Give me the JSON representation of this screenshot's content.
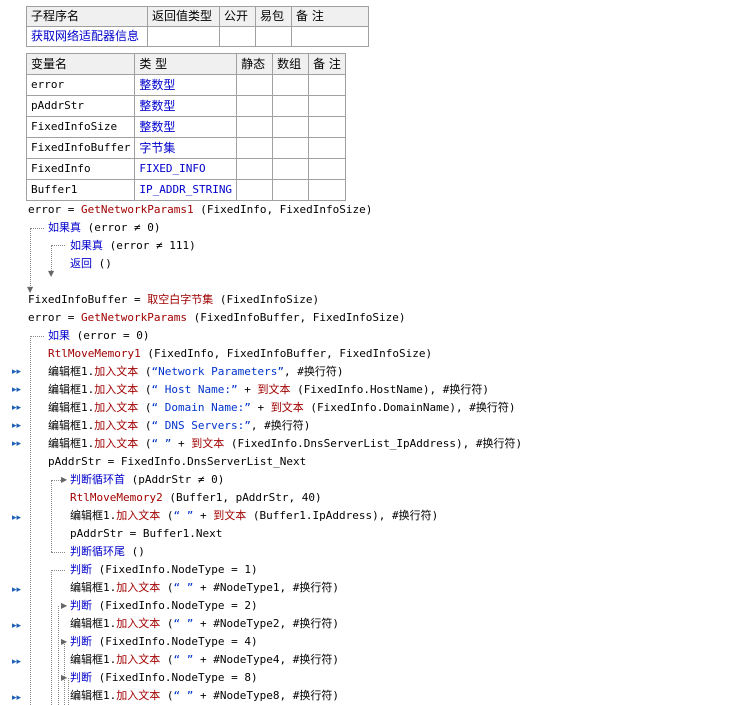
{
  "proc_table": {
    "headers": [
      "子程序名",
      "返回值类型",
      "公开",
      "易包",
      "备 注"
    ],
    "row": [
      "获取网络适配器信息",
      "",
      "",
      "",
      ""
    ]
  },
  "var_table": {
    "headers": [
      "变量名",
      "类 型",
      "静态",
      "数组",
      "备 注"
    ],
    "rows": [
      {
        "name": "error",
        "type": "整数型"
      },
      {
        "name": "pAddrStr",
        "type": "整数型"
      },
      {
        "name": "FixedInfoSize",
        "type": "整数型"
      },
      {
        "name": "FixedInfoBuffer",
        "type": "字节集"
      },
      {
        "name": "FixedInfo",
        "type": "FIXED_INFO"
      },
      {
        "name": "Buffer1",
        "type": "IP_ADDR_STRING"
      }
    ]
  },
  "code": {
    "l1": {
      "a": "error",
      "b": " = ",
      "c": "GetNetworkParams1",
      "d": " (FixedInfo, FixedInfoSize)"
    },
    "l2": {
      "a": "如果真",
      "b": " (error ≠ 0)"
    },
    "l3": {
      "a": "如果真",
      "b": " (error ≠ 111)"
    },
    "l4": {
      "a": "返回",
      "b": " ()"
    },
    "l5": {
      "a": "FixedInfoBuffer = ",
      "b": "取空白字节集",
      "c": " (FixedInfoSize)"
    },
    "l6": {
      "a": "error = ",
      "b": "GetNetworkParams",
      "c": " (FixedInfoBuffer, FixedInfoSize)"
    },
    "l7": {
      "a": "如果",
      "b": " (error = 0)"
    },
    "l8": {
      "a": "RtlMoveMemory1",
      "b": " (FixedInfo, FixedInfoBuffer, FixedInfoSize)"
    },
    "l9": {
      "a": "编辑框1.",
      "b": "加入文本",
      "c": " (",
      "d": "“Network Parameters”",
      "e": ", #换行符)"
    },
    "l10": {
      "a": "编辑框1.",
      "b": "加入文本",
      "c": " (",
      "d": "“  Host Name:”",
      "e": " + ",
      "f": "到文本",
      "g": " (FixedInfo.HostName), #换行符)"
    },
    "l11": {
      "a": "编辑框1.",
      "b": "加入文本",
      "c": " (",
      "d": "“  Domain Name:”",
      "e": " + ",
      "f": "到文本",
      "g": " (FixedInfo.DomainName), #换行符)"
    },
    "l12": {
      "a": "编辑框1.",
      "b": "加入文本",
      "c": " (",
      "d": "“  DNS Servers:”",
      "e": ", #换行符)"
    },
    "l13": {
      "a": "编辑框1.",
      "b": "加入文本",
      "c": " (",
      "d": "“    ”",
      "e": " + ",
      "f": "到文本",
      "g": " (FixedInfo.DnsServerList_IpAddress), #换行符)"
    },
    "l14": {
      "a": "pAddrStr = FixedInfo.DnsServerList_Next"
    },
    "l15": {
      "a": "判断循环首",
      "b": " (pAddrStr ≠ 0)"
    },
    "l16": {
      "a": "RtlMoveMemory2",
      "b": " (Buffer1, pAddrStr, 40)"
    },
    "l17": {
      "a": "编辑框1.",
      "b": "加入文本",
      "c": " (",
      "d": "“    ”",
      "e": " + ",
      "f": "到文本",
      "g": " (Buffer1.IpAddress), #换行符)"
    },
    "l18": {
      "a": "pAddrStr = Buffer1.Next"
    },
    "l19": {
      "a": "判断循环尾",
      "b": " ()"
    },
    "l20": {
      "a": "判断",
      "b": " (FixedInfo.NodeType = 1)"
    },
    "l21": {
      "a": "编辑框1.",
      "b": "加入文本",
      "c": " (",
      "d": "“  ”",
      "e": " + #NodeType1, #换行符)"
    },
    "l22": {
      "a": "判断",
      "b": " (FixedInfo.NodeType = 2)"
    },
    "l23": {
      "a": "编辑框1.",
      "b": "加入文本",
      "c": " (",
      "d": "“  ”",
      "e": " + #NodeType2, #换行符)"
    },
    "l24": {
      "a": "判断",
      "b": " (FixedInfo.NodeType = 4)"
    },
    "l25": {
      "a": "编辑框1.",
      "b": "加入文本",
      "c": " (",
      "d": "“  ”",
      "e": " + #NodeType4, #换行符)"
    },
    "l26": {
      "a": "判断",
      "b": " (FixedInfo.NodeType = 8)"
    },
    "l27": {
      "a": "编辑框1.",
      "b": "加入文本",
      "c": " (",
      "d": "“  ”",
      "e": " + #NodeType8, #换行符)"
    }
  },
  "gutter_marker": "▸▸"
}
